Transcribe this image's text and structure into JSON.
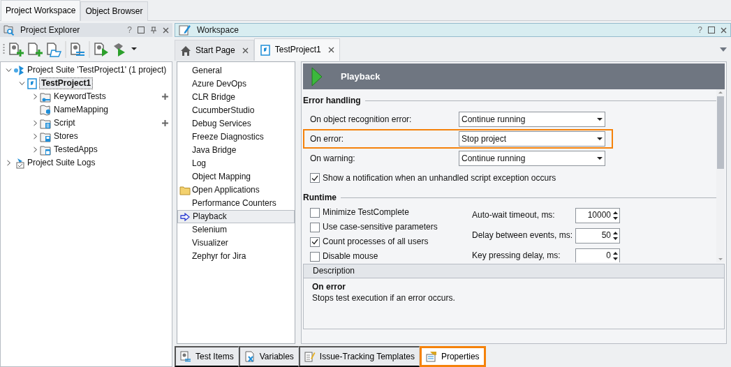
{
  "top_tabs": [
    {
      "label": "Project Workspace",
      "selected": true
    },
    {
      "label": "Object Browser",
      "selected": false
    }
  ],
  "explorer": {
    "title": "Project Explorer",
    "help": "?",
    "tree": [
      {
        "label": "Project Suite 'TestProject1' (1 project)",
        "kind": "suite",
        "expandable": true,
        "expanded": true,
        "selected": false,
        "children": [
          {
            "label": "TestProject1",
            "kind": "project",
            "expandable": true,
            "expanded": true,
            "selected": true,
            "children": [
              {
                "label": "KeywordTests",
                "kind": "keyword-folder",
                "expandable": true,
                "expanded": false,
                "selected": false,
                "add": true
              },
              {
                "label": "NameMapping",
                "kind": "mapping",
                "expandable": false,
                "expanded": false,
                "selected": false,
                "add": false
              },
              {
                "label": "Script",
                "kind": "script-folder",
                "expandable": true,
                "expanded": false,
                "selected": false,
                "add": true
              },
              {
                "label": "Stores",
                "kind": "stores-folder",
                "expandable": true,
                "expanded": false,
                "selected": false,
                "add": false
              },
              {
                "label": "TestedApps",
                "kind": "apps-folder",
                "expandable": true,
                "expanded": false,
                "selected": false,
                "add": false
              }
            ]
          }
        ]
      },
      {
        "label": "Project Suite Logs",
        "kind": "logs",
        "expandable": true,
        "expanded": false,
        "selected": false
      }
    ]
  },
  "workspace": {
    "title": "Workspace",
    "help": "?",
    "doc_tabs": [
      {
        "label": "Start Page",
        "kind": "home",
        "selected": false
      },
      {
        "label": "TestProject1",
        "kind": "project",
        "selected": true
      }
    ],
    "categories": [
      {
        "label": "General",
        "kind": "page",
        "selected": false
      },
      {
        "label": "Azure DevOps",
        "kind": "page",
        "selected": false
      },
      {
        "label": "CLR Bridge",
        "kind": "page",
        "selected": false
      },
      {
        "label": "CucumberStudio",
        "kind": "page",
        "selected": false
      },
      {
        "label": "Debug Services",
        "kind": "page",
        "selected": false
      },
      {
        "label": "Freeze Diagnostics",
        "kind": "page",
        "selected": false
      },
      {
        "label": "Java Bridge",
        "kind": "page",
        "selected": false
      },
      {
        "label": "Log",
        "kind": "page",
        "selected": false
      },
      {
        "label": "Object Mapping",
        "kind": "page",
        "selected": false
      },
      {
        "label": "Open Applications",
        "kind": "folder",
        "selected": false
      },
      {
        "label": "Performance Counters",
        "kind": "page",
        "selected": false
      },
      {
        "label": "Playback",
        "kind": "page",
        "selected": true
      },
      {
        "label": "Selenium",
        "kind": "page",
        "selected": false
      },
      {
        "label": "Visualizer",
        "kind": "page",
        "selected": false
      },
      {
        "label": "Zephyr for Jira",
        "kind": "page",
        "selected": false
      }
    ],
    "settings": {
      "title": "Playback",
      "error_handling": {
        "title": "Error handling",
        "rows": [
          {
            "kind": "dropdown",
            "label": "On object recognition error:",
            "value": "Continue running",
            "highlighted": false
          },
          {
            "kind": "dropdown",
            "label": "On error:",
            "value": "Stop project",
            "highlighted": true
          },
          {
            "kind": "dropdown",
            "label": "On warning:",
            "value": "Continue running",
            "highlighted": false
          },
          {
            "kind": "checkbox",
            "label": "Show a notification when an unhandled script exception occurs",
            "checked": true,
            "highlighted": false
          }
        ]
      },
      "runtime": {
        "title": "Runtime",
        "checkboxes": [
          {
            "label": "Minimize TestComplete",
            "checked": false
          },
          {
            "label": "Use case-sensitive parameters",
            "checked": false
          },
          {
            "label": "Count processes of all users",
            "checked": true
          },
          {
            "label": "Disable mouse",
            "checked": false
          }
        ],
        "spinners": [
          {
            "label": "Auto-wait timeout, ms:",
            "value": "10000"
          },
          {
            "label": "Delay between events, ms:",
            "value": "50"
          },
          {
            "label": "Key pressing delay, ms:",
            "value": "0"
          }
        ]
      }
    },
    "description": {
      "heading": "Description",
      "title": "On error",
      "text": "Stops test execution if an error occurs."
    }
  },
  "bottom_tabs": [
    {
      "label": "Test Items",
      "kind": "items",
      "selected": false,
      "highlighted": false
    },
    {
      "label": "Variables",
      "kind": "variables",
      "selected": false,
      "highlighted": false
    },
    {
      "label": "Issue-Tracking Templates",
      "kind": "templates",
      "selected": false,
      "highlighted": false
    },
    {
      "label": "Properties",
      "kind": "properties",
      "selected": true,
      "highlighted": true
    }
  ]
}
